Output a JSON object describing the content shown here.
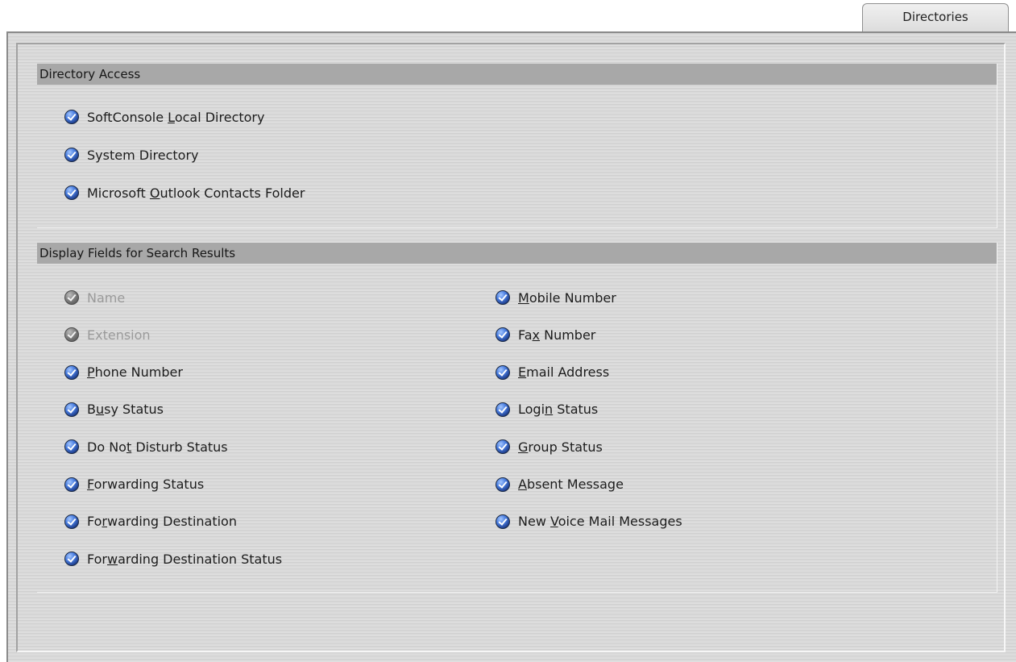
{
  "tab": {
    "label": "Directories"
  },
  "directory_access": {
    "title": "Directory Access",
    "options": [
      {
        "pre": "SoftConsole ",
        "key": "L",
        "post": "ocal Directory",
        "checked": true,
        "enabled": true
      },
      {
        "pre": "System Directory",
        "key": "",
        "post": "",
        "checked": true,
        "enabled": true
      },
      {
        "pre": "Microsoft ",
        "key": "O",
        "post": "utlook Contacts Folder",
        "checked": true,
        "enabled": true
      }
    ]
  },
  "display_fields": {
    "title": "Display Fields for Search Results",
    "left": [
      {
        "pre": "Name",
        "key": "",
        "post": "",
        "checked": true,
        "enabled": false
      },
      {
        "pre": "Extension",
        "key": "",
        "post": "",
        "checked": true,
        "enabled": false
      },
      {
        "pre": "",
        "key": "P",
        "post": "hone Number",
        "checked": true,
        "enabled": true
      },
      {
        "pre": "B",
        "key": "u",
        "post": "sy Status",
        "checked": true,
        "enabled": true
      },
      {
        "pre": "Do No",
        "key": "t",
        "post": " Disturb Status",
        "checked": true,
        "enabled": true
      },
      {
        "pre": "",
        "key": "F",
        "post": "orwarding Status",
        "checked": true,
        "enabled": true
      },
      {
        "pre": "Fo",
        "key": "r",
        "post": "warding Destination",
        "checked": true,
        "enabled": true
      },
      {
        "pre": "For",
        "key": "w",
        "post": "arding Destination Status",
        "checked": true,
        "enabled": true
      }
    ],
    "right": [
      {
        "pre": "",
        "key": "M",
        "post": "obile Number",
        "checked": true,
        "enabled": true
      },
      {
        "pre": "Fa",
        "key": "x",
        "post": " Number",
        "checked": true,
        "enabled": true
      },
      {
        "pre": "",
        "key": "E",
        "post": "mail Address",
        "checked": true,
        "enabled": true
      },
      {
        "pre": "Logi",
        "key": "n",
        "post": " Status",
        "checked": true,
        "enabled": true
      },
      {
        "pre": "",
        "key": "G",
        "post": "roup Status",
        "checked": true,
        "enabled": true
      },
      {
        "pre": "",
        "key": "A",
        "post": "bsent Message",
        "checked": true,
        "enabled": true
      },
      {
        "pre": "New ",
        "key": "V",
        "post": "oice Mail Messages",
        "checked": true,
        "enabled": true
      }
    ]
  },
  "colors": {
    "panel": "#dadada",
    "header": "#a8a8a8",
    "check_active": "#3a6fd6",
    "check_disabled": "#808080"
  }
}
